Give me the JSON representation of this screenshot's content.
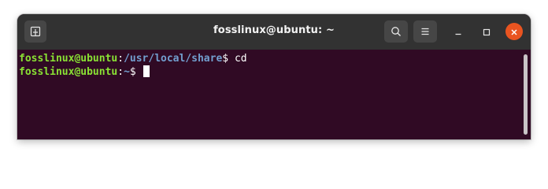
{
  "window": {
    "title": "fosslinux@ubuntu: ~"
  },
  "titlebar": {
    "new_tab_icon": "new-tab-icon",
    "search_icon": "search-icon",
    "menu_icon": "hamburger-menu-icon",
    "minimize_icon": "minimize-icon",
    "maximize_icon": "maximize-icon",
    "close_icon": "close-icon"
  },
  "terminal": {
    "lines": [
      {
        "user_host": "fosslinux@ubuntu",
        "separator": ":",
        "path": "/usr/local/share",
        "prompt_symbol": "$",
        "command": " cd"
      },
      {
        "user_host": "fosslinux@ubuntu",
        "separator": ":",
        "path": "~",
        "prompt_symbol": "$",
        "command": " "
      }
    ]
  },
  "colors": {
    "terminal_background": "#300a24",
    "titlebar_background": "#323232",
    "user_host": "#8ae234",
    "path": "#729fcf",
    "close_button": "#e95420"
  }
}
